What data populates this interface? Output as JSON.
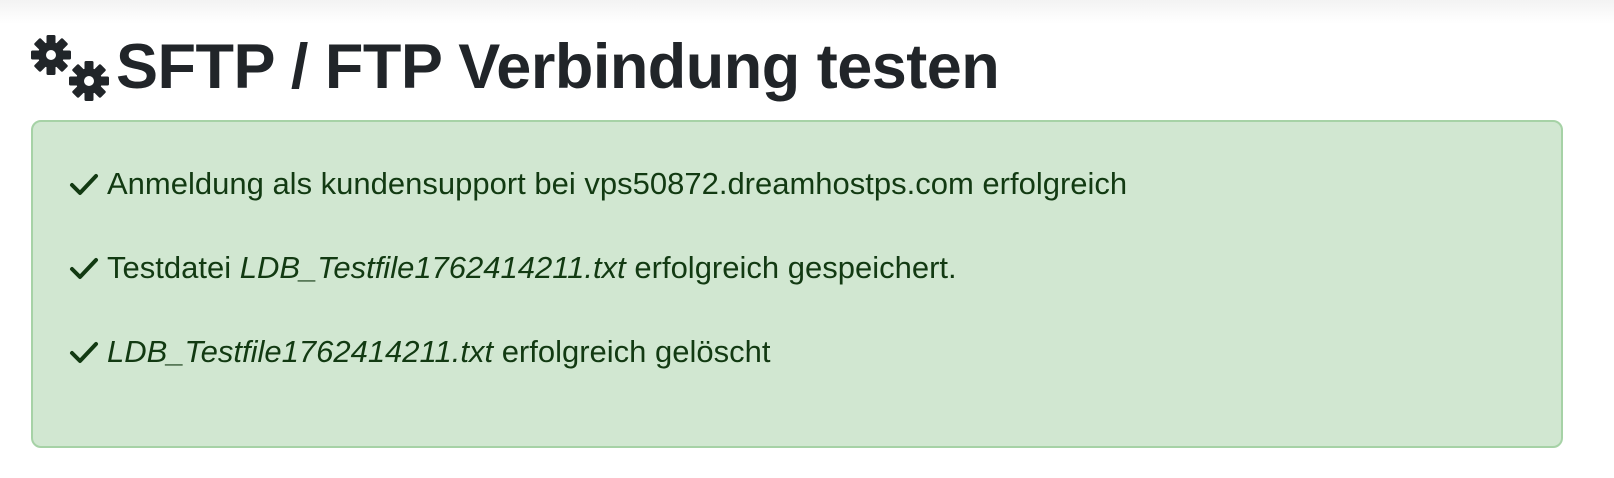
{
  "header": {
    "icon": "gears-icon",
    "title": "SFTP / FTP Verbindung testen"
  },
  "alert": {
    "color_bg": "#d1e7d1",
    "color_border": "#a6d2a6",
    "color_text": "#123a12",
    "messages": [
      {
        "icon": "check-icon",
        "text": "Anmeldung als kundensupport bei vps50872.dreamhostps.com erfolgreich"
      },
      {
        "icon": "check-icon",
        "prefix": "Testdatei",
        "filename": "LDB_Testfile1762414211.txt",
        "suffix": "erfolgreich gespeichert."
      },
      {
        "icon": "check-icon",
        "filename": "LDB_Testfile1762414211.txt",
        "suffix": "erfolgreich gelöscht"
      }
    ]
  }
}
